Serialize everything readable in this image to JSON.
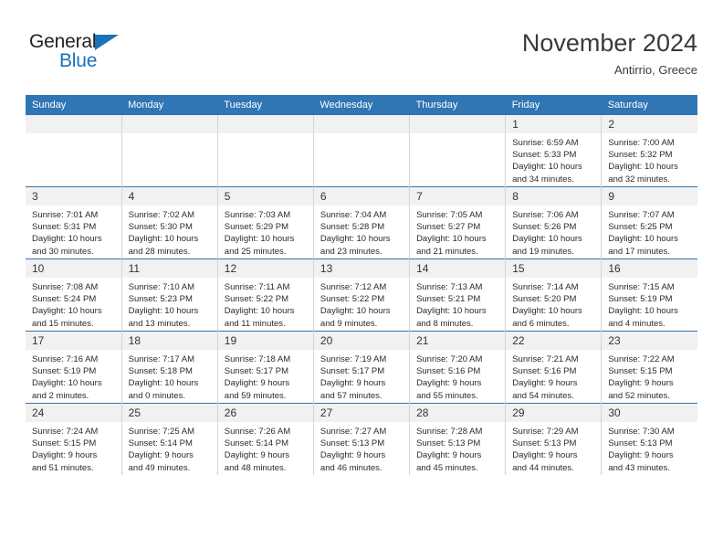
{
  "brand": {
    "name_top": "General",
    "name_bottom": "Blue",
    "triangle_color": "#1a72ba"
  },
  "header": {
    "title": "November 2024",
    "location": "Antirrio, Greece"
  },
  "theme": {
    "header_blue": "#3075b4",
    "daynum_band": "#f1f1f1",
    "cell_border": "#d4d4d4"
  },
  "weekdays": [
    "Sunday",
    "Monday",
    "Tuesday",
    "Wednesday",
    "Thursday",
    "Friday",
    "Saturday"
  ],
  "weeks": [
    [
      {
        "day": "",
        "sunrise": "",
        "sunset": "",
        "daylight_line1": "",
        "daylight_line2": ""
      },
      {
        "day": "",
        "sunrise": "",
        "sunset": "",
        "daylight_line1": "",
        "daylight_line2": ""
      },
      {
        "day": "",
        "sunrise": "",
        "sunset": "",
        "daylight_line1": "",
        "daylight_line2": ""
      },
      {
        "day": "",
        "sunrise": "",
        "sunset": "",
        "daylight_line1": "",
        "daylight_line2": ""
      },
      {
        "day": "",
        "sunrise": "",
        "sunset": "",
        "daylight_line1": "",
        "daylight_line2": ""
      },
      {
        "day": "1",
        "sunrise": "Sunrise: 6:59 AM",
        "sunset": "Sunset: 5:33 PM",
        "daylight_line1": "Daylight: 10 hours",
        "daylight_line2": "and 34 minutes."
      },
      {
        "day": "2",
        "sunrise": "Sunrise: 7:00 AM",
        "sunset": "Sunset: 5:32 PM",
        "daylight_line1": "Daylight: 10 hours",
        "daylight_line2": "and 32 minutes."
      }
    ],
    [
      {
        "day": "3",
        "sunrise": "Sunrise: 7:01 AM",
        "sunset": "Sunset: 5:31 PM",
        "daylight_line1": "Daylight: 10 hours",
        "daylight_line2": "and 30 minutes."
      },
      {
        "day": "4",
        "sunrise": "Sunrise: 7:02 AM",
        "sunset": "Sunset: 5:30 PM",
        "daylight_line1": "Daylight: 10 hours",
        "daylight_line2": "and 28 minutes."
      },
      {
        "day": "5",
        "sunrise": "Sunrise: 7:03 AM",
        "sunset": "Sunset: 5:29 PM",
        "daylight_line1": "Daylight: 10 hours",
        "daylight_line2": "and 25 minutes."
      },
      {
        "day": "6",
        "sunrise": "Sunrise: 7:04 AM",
        "sunset": "Sunset: 5:28 PM",
        "daylight_line1": "Daylight: 10 hours",
        "daylight_line2": "and 23 minutes."
      },
      {
        "day": "7",
        "sunrise": "Sunrise: 7:05 AM",
        "sunset": "Sunset: 5:27 PM",
        "daylight_line1": "Daylight: 10 hours",
        "daylight_line2": "and 21 minutes."
      },
      {
        "day": "8",
        "sunrise": "Sunrise: 7:06 AM",
        "sunset": "Sunset: 5:26 PM",
        "daylight_line1": "Daylight: 10 hours",
        "daylight_line2": "and 19 minutes."
      },
      {
        "day": "9",
        "sunrise": "Sunrise: 7:07 AM",
        "sunset": "Sunset: 5:25 PM",
        "daylight_line1": "Daylight: 10 hours",
        "daylight_line2": "and 17 minutes."
      }
    ],
    [
      {
        "day": "10",
        "sunrise": "Sunrise: 7:08 AM",
        "sunset": "Sunset: 5:24 PM",
        "daylight_line1": "Daylight: 10 hours",
        "daylight_line2": "and 15 minutes."
      },
      {
        "day": "11",
        "sunrise": "Sunrise: 7:10 AM",
        "sunset": "Sunset: 5:23 PM",
        "daylight_line1": "Daylight: 10 hours",
        "daylight_line2": "and 13 minutes."
      },
      {
        "day": "12",
        "sunrise": "Sunrise: 7:11 AM",
        "sunset": "Sunset: 5:22 PM",
        "daylight_line1": "Daylight: 10 hours",
        "daylight_line2": "and 11 minutes."
      },
      {
        "day": "13",
        "sunrise": "Sunrise: 7:12 AM",
        "sunset": "Sunset: 5:22 PM",
        "daylight_line1": "Daylight: 10 hours",
        "daylight_line2": "and 9 minutes."
      },
      {
        "day": "14",
        "sunrise": "Sunrise: 7:13 AM",
        "sunset": "Sunset: 5:21 PM",
        "daylight_line1": "Daylight: 10 hours",
        "daylight_line2": "and 8 minutes."
      },
      {
        "day": "15",
        "sunrise": "Sunrise: 7:14 AM",
        "sunset": "Sunset: 5:20 PM",
        "daylight_line1": "Daylight: 10 hours",
        "daylight_line2": "and 6 minutes."
      },
      {
        "day": "16",
        "sunrise": "Sunrise: 7:15 AM",
        "sunset": "Sunset: 5:19 PM",
        "daylight_line1": "Daylight: 10 hours",
        "daylight_line2": "and 4 minutes."
      }
    ],
    [
      {
        "day": "17",
        "sunrise": "Sunrise: 7:16 AM",
        "sunset": "Sunset: 5:19 PM",
        "daylight_line1": "Daylight: 10 hours",
        "daylight_line2": "and 2 minutes."
      },
      {
        "day": "18",
        "sunrise": "Sunrise: 7:17 AM",
        "sunset": "Sunset: 5:18 PM",
        "daylight_line1": "Daylight: 10 hours",
        "daylight_line2": "and 0 minutes."
      },
      {
        "day": "19",
        "sunrise": "Sunrise: 7:18 AM",
        "sunset": "Sunset: 5:17 PM",
        "daylight_line1": "Daylight: 9 hours",
        "daylight_line2": "and 59 minutes."
      },
      {
        "day": "20",
        "sunrise": "Sunrise: 7:19 AM",
        "sunset": "Sunset: 5:17 PM",
        "daylight_line1": "Daylight: 9 hours",
        "daylight_line2": "and 57 minutes."
      },
      {
        "day": "21",
        "sunrise": "Sunrise: 7:20 AM",
        "sunset": "Sunset: 5:16 PM",
        "daylight_line1": "Daylight: 9 hours",
        "daylight_line2": "and 55 minutes."
      },
      {
        "day": "22",
        "sunrise": "Sunrise: 7:21 AM",
        "sunset": "Sunset: 5:16 PM",
        "daylight_line1": "Daylight: 9 hours",
        "daylight_line2": "and 54 minutes."
      },
      {
        "day": "23",
        "sunrise": "Sunrise: 7:22 AM",
        "sunset": "Sunset: 5:15 PM",
        "daylight_line1": "Daylight: 9 hours",
        "daylight_line2": "and 52 minutes."
      }
    ],
    [
      {
        "day": "24",
        "sunrise": "Sunrise: 7:24 AM",
        "sunset": "Sunset: 5:15 PM",
        "daylight_line1": "Daylight: 9 hours",
        "daylight_line2": "and 51 minutes."
      },
      {
        "day": "25",
        "sunrise": "Sunrise: 7:25 AM",
        "sunset": "Sunset: 5:14 PM",
        "daylight_line1": "Daylight: 9 hours",
        "daylight_line2": "and 49 minutes."
      },
      {
        "day": "26",
        "sunrise": "Sunrise: 7:26 AM",
        "sunset": "Sunset: 5:14 PM",
        "daylight_line1": "Daylight: 9 hours",
        "daylight_line2": "and 48 minutes."
      },
      {
        "day": "27",
        "sunrise": "Sunrise: 7:27 AM",
        "sunset": "Sunset: 5:13 PM",
        "daylight_line1": "Daylight: 9 hours",
        "daylight_line2": "and 46 minutes."
      },
      {
        "day": "28",
        "sunrise": "Sunrise: 7:28 AM",
        "sunset": "Sunset: 5:13 PM",
        "daylight_line1": "Daylight: 9 hours",
        "daylight_line2": "and 45 minutes."
      },
      {
        "day": "29",
        "sunrise": "Sunrise: 7:29 AM",
        "sunset": "Sunset: 5:13 PM",
        "daylight_line1": "Daylight: 9 hours",
        "daylight_line2": "and 44 minutes."
      },
      {
        "day": "30",
        "sunrise": "Sunrise: 7:30 AM",
        "sunset": "Sunset: 5:13 PM",
        "daylight_line1": "Daylight: 9 hours",
        "daylight_line2": "and 43 minutes."
      }
    ]
  ]
}
